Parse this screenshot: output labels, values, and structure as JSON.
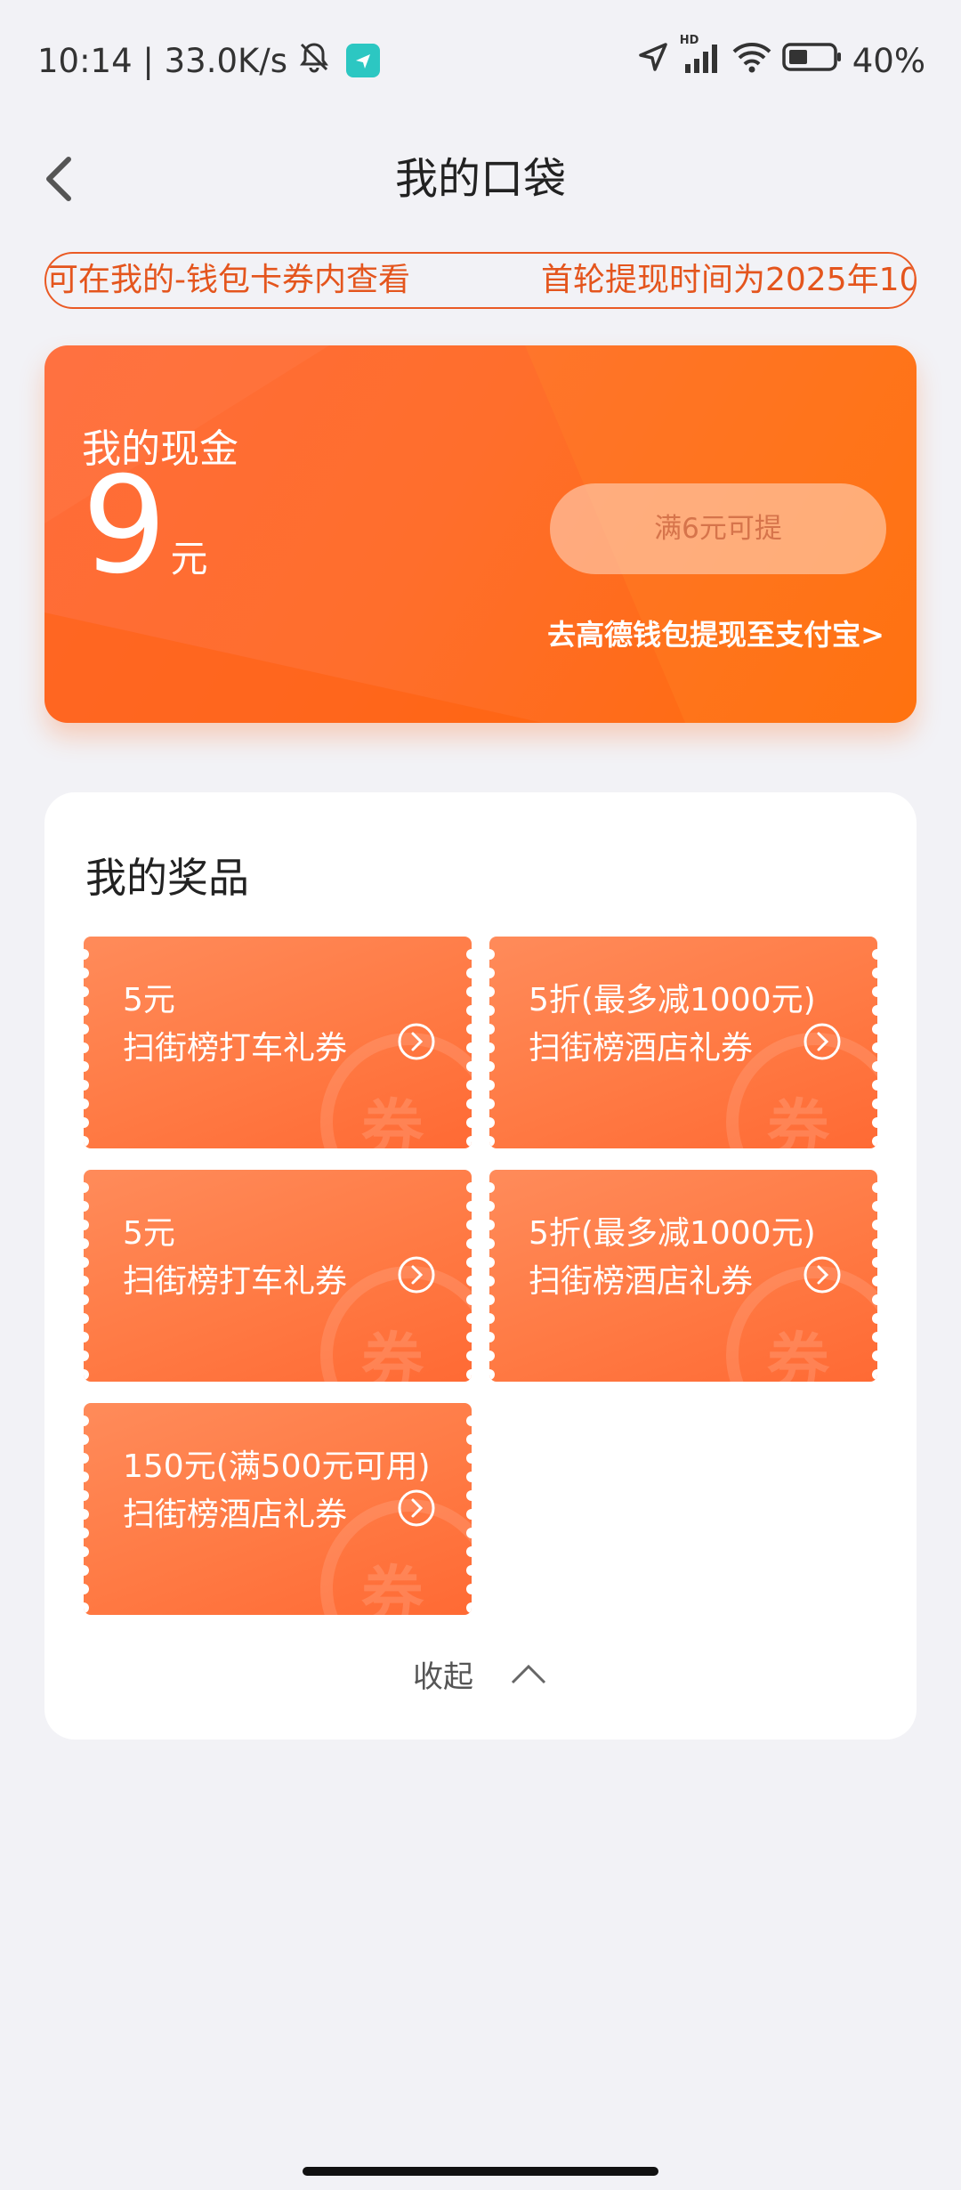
{
  "status_bar": {
    "time_speed": "10:14 | 33.0K/s",
    "battery": "40%",
    "hd_label": "HD"
  },
  "header": {
    "title": "我的口袋"
  },
  "notice": {
    "part1": "可在我的-钱包卡券内查看",
    "part2": "首轮提现时间为2025年10"
  },
  "cash": {
    "label": "我的现金",
    "amount": "9",
    "unit": "元",
    "withdraw_button": "满6元可提",
    "alipay_link": "去高德钱包提现至支付宝>"
  },
  "prizes": {
    "title": "我的奖品",
    "watermark": "券",
    "items": [
      {
        "value": "5元",
        "name": "扫街榜打车礼券"
      },
      {
        "value": "5折(最多减1000元)",
        "name": "扫街榜酒店礼券"
      },
      {
        "value": "5元",
        "name": "扫街榜打车礼券"
      },
      {
        "value": "5折(最多减1000元)",
        "name": "扫街榜酒店礼券"
      },
      {
        "value": "150元(满500元可用)",
        "name": "扫街榜酒店礼券"
      }
    ],
    "collapse_label": "收起"
  },
  "colors": {
    "accent": "#ff6e2c",
    "notice": "#e4551d",
    "background": "#f2f2f6"
  }
}
